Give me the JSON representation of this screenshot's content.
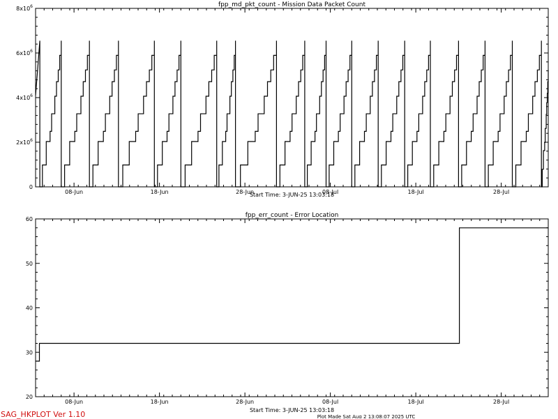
{
  "footer": {
    "program_label": "SAG_HKPLOT  Ver 1.10",
    "plot_made": "Plot Made Sat Aug  2 13:08:07 2025 UTC"
  },
  "chart_data": [
    {
      "type": "line",
      "title": "fpp_md_pkt_count - Mission Data Packet Count",
      "start_time_label": "Start Time:  3-JUN-25  13:03:18",
      "xlim_days": [
        0,
        60
      ],
      "ylim": [
        0,
        8000000
      ],
      "y_ticks": [
        0,
        2000000,
        4000000,
        6000000,
        8000000
      ],
      "y_tick_labels": [
        "0",
        "2x10^6",
        "4x10^6",
        "6x10^6",
        "8x10^6"
      ],
      "x_ticks": [
        4.5,
        14.5,
        24.5,
        34.5,
        44.5,
        54.5
      ],
      "x_tick_labels": [
        "08-Jun",
        "18-Jun",
        "28-Jun",
        "08-Jul",
        "18-Jul",
        "28-Jul"
      ],
      "line_color": "#000000",
      "series": [
        {
          "resets": [
            0.5,
            3.0,
            6.3,
            9.7,
            13.9,
            17.0,
            21.2,
            23.4,
            28.2,
            31.5,
            34.0,
            37.0,
            40.1,
            43.2,
            46.2,
            49.5,
            52.6,
            55.8,
            59.2
          ],
          "peak": 6550000,
          "start_value": 4100000,
          "end_value": 6550000
        }
      ]
    },
    {
      "type": "line",
      "title": "fpp_err_count - Error Location",
      "start_time_label": "Start Time:  3-JUN-25  13:03:18",
      "xlim_days": [
        0,
        60
      ],
      "ylim": [
        20,
        60
      ],
      "y_ticks": [
        20,
        30,
        40,
        50,
        60
      ],
      "y_tick_labels": [
        "20",
        "30",
        "40",
        "50",
        "60"
      ],
      "x_ticks": [
        4.5,
        14.5,
        24.5,
        34.5,
        44.5,
        54.5
      ],
      "x_tick_labels": [
        "08-Jun",
        "18-Jun",
        "28-Jun",
        "08-Jul",
        "18-Jul",
        "28-Jul"
      ],
      "line_color": "#000000",
      "series": [
        {
          "points": [
            [
              0,
              28
            ],
            [
              0.45,
              28
            ],
            [
              0.45,
              32
            ],
            [
              49.6,
              32
            ],
            [
              49.6,
              58
            ],
            [
              60,
              58
            ]
          ]
        }
      ]
    }
  ]
}
